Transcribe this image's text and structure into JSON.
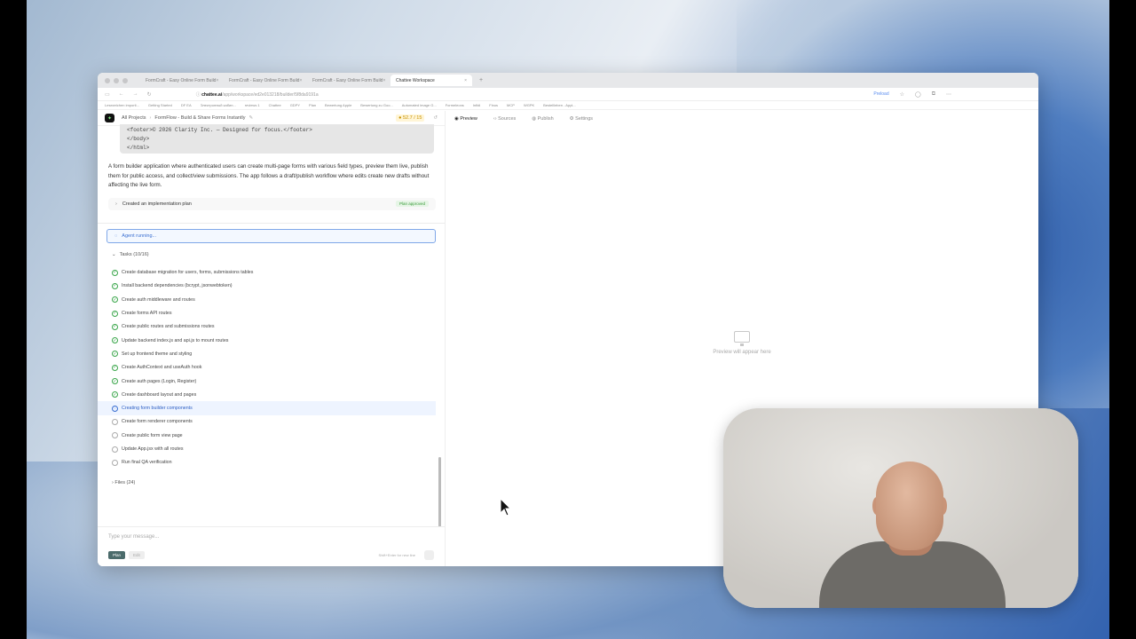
{
  "browser": {
    "tabs": [
      {
        "label": "FormCraft - Easy Online Form Build",
        "active": false
      },
      {
        "label": "FormCraft - Easy Online Form Build",
        "active": false
      },
      {
        "label": "FormCraft - Easy Online Form Build",
        "active": false
      },
      {
        "label": "Chattee Workspace",
        "active": true
      }
    ],
    "url_host": "chattee.ai",
    "url_path": "/app/workspace/ed2e013218/builder/5f8da9191a",
    "pinned_label": "Preload",
    "bookmarks": [
      "Lesezeichen importi...",
      "Getting Started",
      "DF EA",
      "Электронный кабин...",
      "reviews 1",
      "Chattee",
      "GDPY",
      "Plan",
      "Bewertung Apple",
      "Bewertung zu Goo...",
      "Automated image G...",
      "Formeleons",
      "Infidi",
      "Finos",
      "MCP",
      "WGPK",
      "Bestellleben - Appl..."
    ]
  },
  "project": {
    "logo": "✦",
    "breadcrumb_root": "All Projects",
    "breadcrumb_sep": "›",
    "title": "FormFlow - Build & Share Forms Instantly",
    "credits": "52.7 / 15"
  },
  "code_snippet": [
    "<footer>© 2026 Clarity Inc. — Designed for focus.</footer>",
    "</body>",
    "</html>"
  ],
  "summary": "A form builder application where authenticated users can create multi-page forms with various field types, preview them live, publish them for public access, and collect/view submissions. The app follows a draft/publish workflow where edits create new drafts without affecting the live form.",
  "plan": {
    "label": "Created an implementation plan",
    "badge": "Plan approved"
  },
  "agent_status": "Agent running...",
  "tasks_header": "Tasks (10/16)",
  "tasks": [
    {
      "label": "Create database migration for users, forms, submissions tables",
      "state": "done"
    },
    {
      "label": "Install backend dependencies (bcrypt, jsonwebtoken)",
      "state": "done"
    },
    {
      "label": "Create auth middleware and routes",
      "state": "done"
    },
    {
      "label": "Create forms API routes",
      "state": "done"
    },
    {
      "label": "Create public routes and submissions routes",
      "state": "done"
    },
    {
      "label": "Update backend index.js and api.js to mount routes",
      "state": "done"
    },
    {
      "label": "Set up frontend theme and styling",
      "state": "done"
    },
    {
      "label": "Create AuthContext and useAuth hook",
      "state": "done"
    },
    {
      "label": "Create auth pages (Login, Register)",
      "state": "done"
    },
    {
      "label": "Create dashboard layout and pages",
      "state": "done"
    },
    {
      "label": "Creating form builder components",
      "state": "current"
    },
    {
      "label": "Create form renderer components",
      "state": "todo"
    },
    {
      "label": "Create public form view page",
      "state": "todo"
    },
    {
      "label": "Update App.jsx with all routes",
      "state": "todo"
    },
    {
      "label": "Run final QA verification",
      "state": "todo"
    }
  ],
  "files_label": "Files (24)",
  "composer": {
    "placeholder": "Type your message...",
    "mode_plan": "Plan",
    "mode_edit": "Edit",
    "hint": "Shift+Enter for new line"
  },
  "right_tabs": [
    "Preview",
    "Sources",
    "Publish",
    "Settings"
  ],
  "preview_empty": "Preview will appear here"
}
